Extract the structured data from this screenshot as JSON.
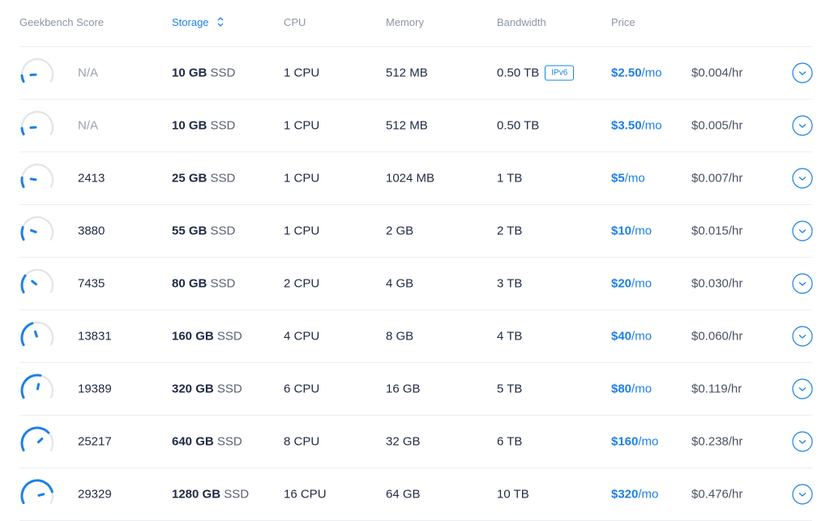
{
  "columns": {
    "geekbench": "Geekbench Score",
    "storage": "Storage",
    "cpu": "CPU",
    "memory": "Memory",
    "bandwidth": "Bandwidth",
    "price": "Price"
  },
  "accent_color": "#1c80e8",
  "plans": [
    {
      "score": "N/A",
      "gauge_fraction": 0.1,
      "storage_amount": "10 GB",
      "storage_type": "SSD",
      "cpu": "1 CPU",
      "memory": "512 MB",
      "bandwidth": "0.50 TB",
      "badge": "IPv6",
      "price_amount": "$2.50",
      "price_unit": "/mo",
      "hourly": "$0.004/hr"
    },
    {
      "score": "N/A",
      "gauge_fraction": 0.1,
      "storage_amount": "10 GB",
      "storage_type": "SSD",
      "cpu": "1 CPU",
      "memory": "512 MB",
      "bandwidth": "0.50 TB",
      "badge": "",
      "price_amount": "$3.50",
      "price_unit": "/mo",
      "hourly": "$0.005/hr"
    },
    {
      "score": "2413",
      "gauge_fraction": 0.15,
      "storage_amount": "25 GB",
      "storage_type": "SSD",
      "cpu": "1 CPU",
      "memory": "1024 MB",
      "bandwidth": "1 TB",
      "badge": "",
      "price_amount": "$5",
      "price_unit": "/mo",
      "hourly": "$0.007/hr"
    },
    {
      "score": "3880",
      "gauge_fraction": 0.2,
      "storage_amount": "55 GB",
      "storage_type": "SSD",
      "cpu": "1 CPU",
      "memory": "2 GB",
      "bandwidth": "2 TB",
      "badge": "",
      "price_amount": "$10",
      "price_unit": "/mo",
      "hourly": "$0.015/hr"
    },
    {
      "score": "7435",
      "gauge_fraction": 0.28,
      "storage_amount": "80 GB",
      "storage_type": "SSD",
      "cpu": "2 CPU",
      "memory": "4 GB",
      "bandwidth": "3 TB",
      "badge": "",
      "price_amount": "$20",
      "price_unit": "/mo",
      "hourly": "$0.030/hr"
    },
    {
      "score": "13831",
      "gauge_fraction": 0.42,
      "storage_amount": "160 GB",
      "storage_type": "SSD",
      "cpu": "4 CPU",
      "memory": "8 GB",
      "bandwidth": "4 TB",
      "badge": "",
      "price_amount": "$40",
      "price_unit": "/mo",
      "hourly": "$0.060/hr"
    },
    {
      "score": "19389",
      "gauge_fraction": 0.55,
      "storage_amount": "320 GB",
      "storage_type": "SSD",
      "cpu": "6 CPU",
      "memory": "16 GB",
      "bandwidth": "5 TB",
      "badge": "",
      "price_amount": "$80",
      "price_unit": "/mo",
      "hourly": "$0.119/hr"
    },
    {
      "score": "25217",
      "gauge_fraction": 0.7,
      "storage_amount": "640 GB",
      "storage_type": "SSD",
      "cpu": "8 CPU",
      "memory": "32 GB",
      "bandwidth": "6 TB",
      "badge": "",
      "price_amount": "$160",
      "price_unit": "/mo",
      "hourly": "$0.238/hr"
    },
    {
      "score": "29329",
      "gauge_fraction": 0.82,
      "storage_amount": "1280 GB",
      "storage_type": "SSD",
      "cpu": "16 CPU",
      "memory": "64 GB",
      "bandwidth": "10 TB",
      "badge": "",
      "price_amount": "$320",
      "price_unit": "/mo",
      "hourly": "$0.476/hr"
    }
  ]
}
